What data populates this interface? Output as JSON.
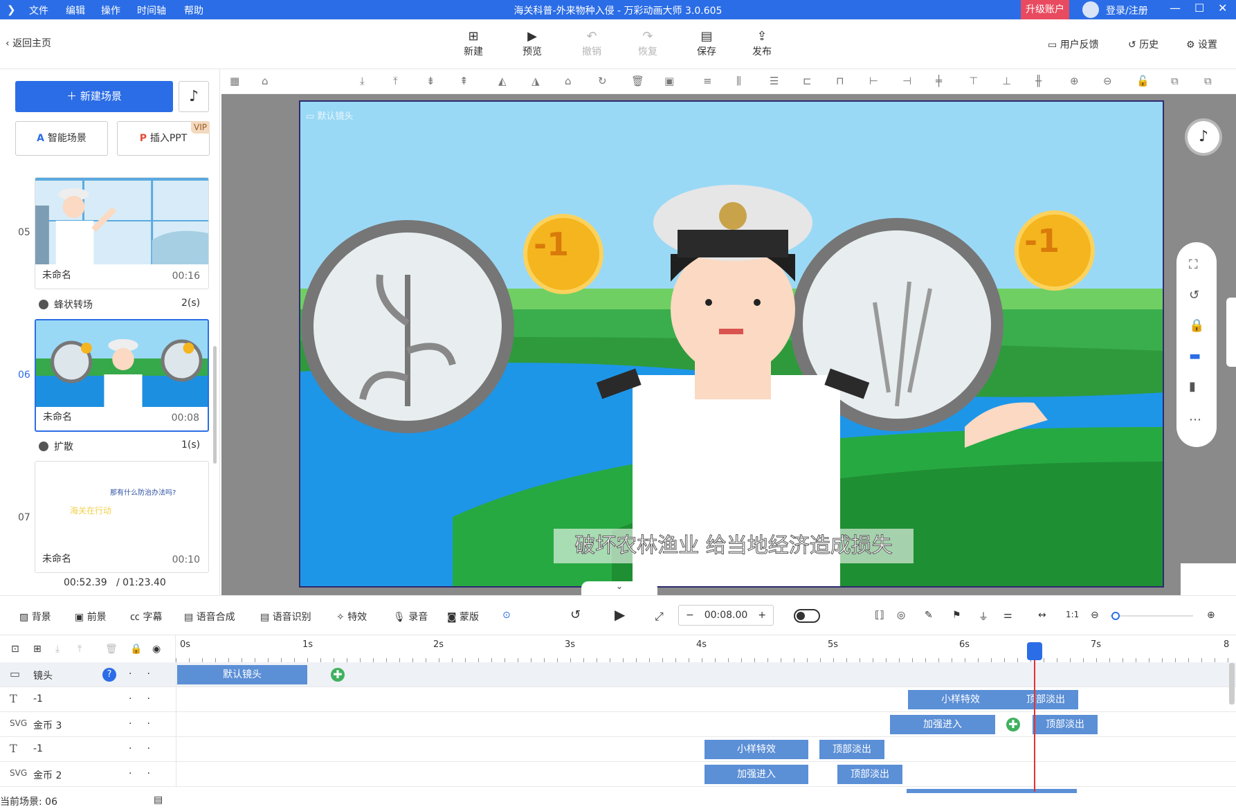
{
  "titlebar": {
    "menu": [
      "文件",
      "编辑",
      "操作",
      "时间轴",
      "帮助"
    ],
    "title": "海关科普-外来物种入侵 - 万彩动画大师 3.0.605",
    "upgrade": "升级账户",
    "login": "登录/注册"
  },
  "toolbar": {
    "back": "返回主页",
    "buttons": [
      "新建",
      "预览",
      "撤销",
      "恢复",
      "保存",
      "发布"
    ],
    "feedback": "用户反馈",
    "history": "历史",
    "settings": "设置"
  },
  "left": {
    "new_scene": "新建场景",
    "smart_scene": "智能场景",
    "insert_ppt": "插入PPT",
    "vip": "VIP",
    "scenes": [
      {
        "no": "05",
        "name": "未命名",
        "time": "00:16"
      },
      {
        "no": "06",
        "name": "未命名",
        "time": "00:08"
      },
      {
        "no": "07",
        "name": "未命名",
        "time": "00:10"
      }
    ],
    "transitions": [
      {
        "name": "蜂状转场",
        "time": "2(s)"
      },
      {
        "name": "扩散",
        "time": "1(s)"
      }
    ],
    "scene07_text": [
      "那有什么防治办法吗?",
      "海关在行动"
    ],
    "time_current": "00:52.39",
    "time_total": "/ 01:23.40"
  },
  "stage": {
    "camera_label": "默认镜头",
    "subtitle": "破坏农林渔业 给当地经济造成损失",
    "coin_text": "-1"
  },
  "track_tools": {
    "items": [
      "背景",
      "前景",
      "字幕",
      "语音合成",
      "语音识别",
      "特效",
      "录音",
      "蒙版"
    ],
    "timecode": "00:08.00"
  },
  "timeline": {
    "ticks": [
      "0s",
      "1s",
      "2s",
      "3s",
      "4s",
      "5s",
      "6s",
      "7s",
      "8"
    ],
    "rows": [
      {
        "label": "镜头",
        "clips": [
          "默认镜头"
        ]
      },
      {
        "label": "-1",
        "clips": [
          "小样特效",
          "顶部淡出"
        ]
      },
      {
        "label": "金币 3",
        "clips": [
          "加强进入",
          "顶部淡出"
        ]
      },
      {
        "label": "-1",
        "clips": [
          "小样特效",
          "顶部淡出"
        ]
      },
      {
        "label": "金币 2",
        "clips": [
          "加强进入",
          "顶部淡出"
        ]
      }
    ],
    "current_scene": "当前场景: 06"
  },
  "colors": {
    "accent": "#2b6de6",
    "clip": "#5b8fd6",
    "playhead": "#e8302f"
  }
}
